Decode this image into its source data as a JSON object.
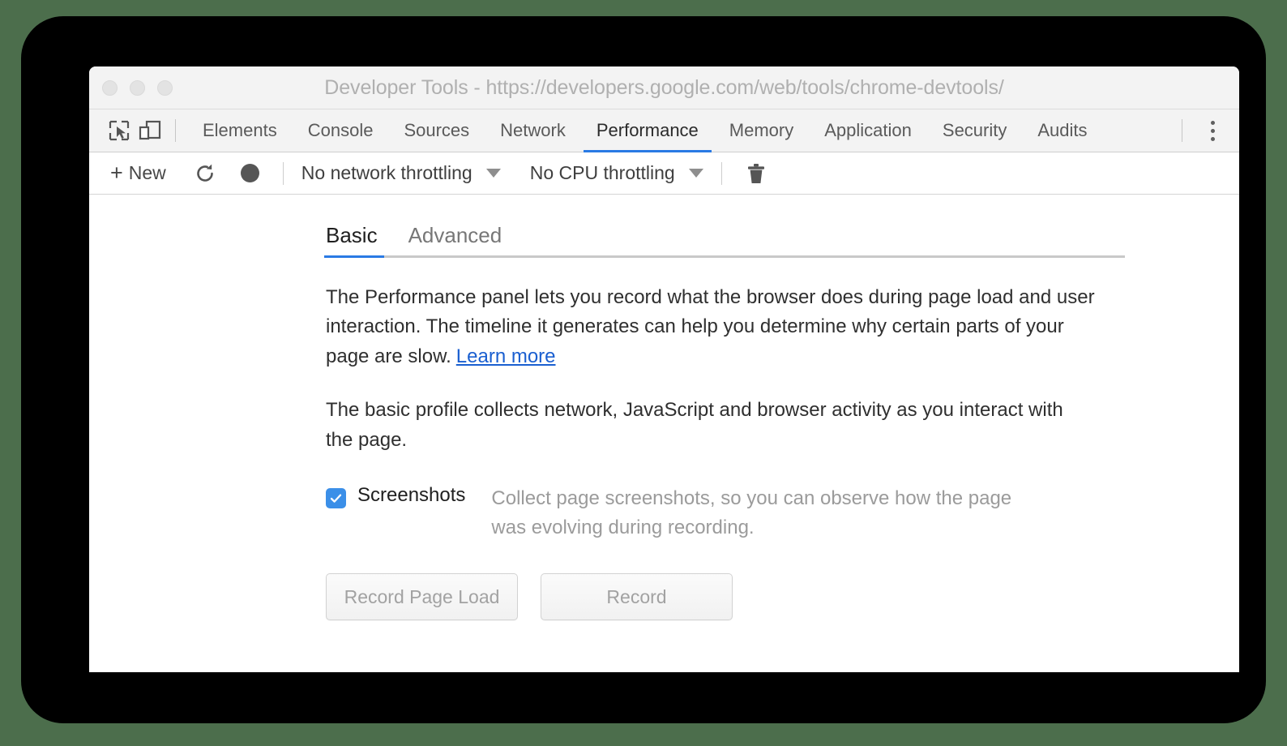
{
  "theme": {
    "page_background": "#4c6e4c",
    "frame_color": "#000000",
    "accent_blue": "#2a7ae4",
    "link_blue": "#1a5fd0",
    "checkbox_blue": "#3b8fe8",
    "muted_text": "#9b9b9b"
  },
  "title_bar": {
    "title": "Developer Tools - https://developers.google.com/web/tools/chrome-devtools/",
    "traffic_lights": [
      "close",
      "minimize",
      "maximize"
    ]
  },
  "panel_tabbar": {
    "icons": [
      {
        "name": "inspect-element-icon",
        "label": "Inspect element"
      },
      {
        "name": "device-toolbar-icon",
        "label": "Toggle device toolbar"
      }
    ],
    "tabs": [
      {
        "label": "Elements",
        "active": false
      },
      {
        "label": "Console",
        "active": false
      },
      {
        "label": "Sources",
        "active": false
      },
      {
        "label": "Network",
        "active": false
      },
      {
        "label": "Performance",
        "active": true
      },
      {
        "label": "Memory",
        "active": false
      },
      {
        "label": "Application",
        "active": false
      },
      {
        "label": "Security",
        "active": false
      },
      {
        "label": "Audits",
        "active": false
      }
    ],
    "more_menu": "kebab-menu-icon"
  },
  "record_toolbar": {
    "new_label": "New",
    "plus_glyph": "+",
    "reload_icon": "reload-icon",
    "record_icon": "record-circle-icon",
    "network_throttling": "No network throttling",
    "cpu_throttling": "No CPU throttling",
    "trash_icon": "trash-icon"
  },
  "landing": {
    "mode_tabs": [
      {
        "label": "Basic",
        "active": true
      },
      {
        "label": "Advanced",
        "active": false
      }
    ],
    "paragraph_intro": "The Performance panel lets you record what the browser does during page load and user interaction. The timeline it generates can help you determine why certain parts of your page are slow.",
    "learn_more_label": "Learn more",
    "paragraph_basic": "The basic profile collects network, JavaScript and browser activity as you interact with the page.",
    "screenshots": {
      "checked": true,
      "label": "Screenshots",
      "description": "Collect page screenshots, so you can observe how the page was evolving during recording."
    },
    "buttons": {
      "record_page_load": "Record Page Load",
      "record": "Record"
    }
  }
}
